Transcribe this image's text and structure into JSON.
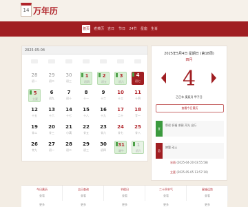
{
  "app": {
    "logo_icon_text": "14",
    "title": "万年历"
  },
  "nav": {
    "items": [
      "首页",
      "老黄历",
      "吉日",
      "节日",
      "24节",
      "星座",
      "生肖"
    ],
    "active_index": 0
  },
  "calendar": {
    "header_date": "2025-05-04",
    "weeks": [
      [
        {
          "d": "28",
          "l": "初一",
          "t": "prev"
        },
        {
          "d": "29",
          "l": "初二",
          "t": "prev"
        },
        {
          "d": "30",
          "l": "初三",
          "t": "prev"
        },
        {
          "d": "1",
          "l": "初四",
          "t": "rest",
          "b": "休"
        },
        {
          "d": "2",
          "l": "初五",
          "t": "rest",
          "b": "休"
        },
        {
          "d": "3",
          "l": "初六",
          "t": "rest",
          "b": "休"
        },
        {
          "d": "4",
          "l": "初七",
          "t": "today",
          "b": "休"
        }
      ],
      [
        {
          "d": "5",
          "l": "立夏",
          "t": "rest",
          "b": "休"
        },
        {
          "d": "6",
          "l": "初九",
          "t": ""
        },
        {
          "d": "7",
          "l": "初十",
          "t": ""
        },
        {
          "d": "8",
          "l": "十一",
          "t": ""
        },
        {
          "d": "9",
          "l": "十二",
          "t": ""
        },
        {
          "d": "10",
          "l": "十三",
          "t": "wknd"
        },
        {
          "d": "11",
          "l": "十四",
          "t": "wknd"
        }
      ],
      [
        {
          "d": "12",
          "l": "十五",
          "t": ""
        },
        {
          "d": "13",
          "l": "十六",
          "t": ""
        },
        {
          "d": "14",
          "l": "十七",
          "t": ""
        },
        {
          "d": "15",
          "l": "十八",
          "t": ""
        },
        {
          "d": "16",
          "l": "十九",
          "t": ""
        },
        {
          "d": "17",
          "l": "二十",
          "t": "wknd"
        },
        {
          "d": "18",
          "l": "廿一",
          "t": "wknd"
        }
      ],
      [
        {
          "d": "19",
          "l": "廿二",
          "t": ""
        },
        {
          "d": "20",
          "l": "廿三",
          "t": ""
        },
        {
          "d": "21",
          "l": "小满",
          "t": ""
        },
        {
          "d": "22",
          "l": "廿五",
          "t": ""
        },
        {
          "d": "23",
          "l": "廿六",
          "t": ""
        },
        {
          "d": "24",
          "l": "廿七",
          "t": "wknd"
        },
        {
          "d": "25",
          "l": "廿八",
          "t": "wknd"
        }
      ],
      [
        {
          "d": "26",
          "l": "廿九",
          "t": ""
        },
        {
          "d": "27",
          "l": "初一",
          "t": ""
        },
        {
          "d": "28",
          "l": "初二",
          "t": ""
        },
        {
          "d": "29",
          "l": "初三",
          "t": ""
        },
        {
          "d": "30",
          "l": "初四",
          "t": ""
        },
        {
          "d": "31",
          "l": "端午",
          "t": "rest",
          "b": "休"
        },
        {
          "d": "1",
          "l": "初六",
          "t": "rest faded",
          "b": "休"
        }
      ]
    ]
  },
  "side": {
    "date_line": "2025年5月4日 星期日 (第18周)",
    "sub_line": "四月",
    "day": "4",
    "ganzhi": "乙巳年 庚辰月 甲子日",
    "button": "查看今日黄历",
    "yi_label": "宜",
    "yi_text": "祭祀 祈福 求嗣 开光 出行",
    "ji_label": "忌",
    "ji_text": "嫁娶 动土",
    "term1_name": "谷雨",
    "term1_time": "(2025-04-20 03:55:58)",
    "term2_name": "立夏",
    "term2_time": "(2025-05-05 13:57:10)"
  },
  "bottom": {
    "items": [
      {
        "t": "今日黄历",
        "s": "查看"
      },
      {
        "t": "吉日查询",
        "s": "查看"
      },
      {
        "t": "节假日",
        "s": "查看"
      },
      {
        "t": "二十四节气",
        "s": "查看"
      },
      {
        "t": "星座运势",
        "s": "查看"
      }
    ],
    "row2": [
      "更多",
      "更多",
      "更多",
      "更多",
      "更多"
    ]
  }
}
